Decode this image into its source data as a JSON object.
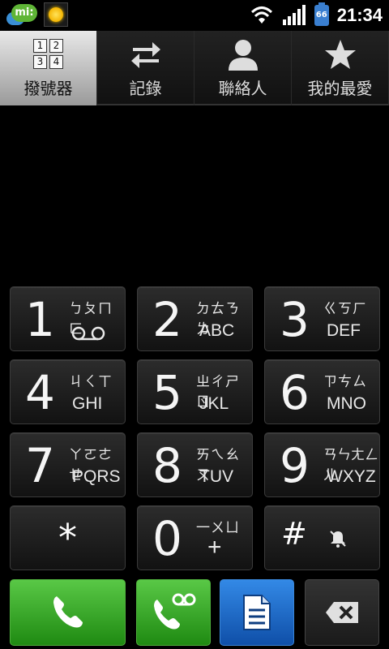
{
  "status_bar": {
    "mi_label": "mi:",
    "battery_level": "66",
    "time": "21:34"
  },
  "tabs": [
    {
      "label": "撥號器",
      "icon": "dialpad-icon",
      "active": true,
      "grid_digits": [
        "1",
        "2",
        "3",
        "4"
      ]
    },
    {
      "label": "記錄",
      "icon": "swap-arrows-icon",
      "active": false
    },
    {
      "label": "聯絡人",
      "icon": "person-icon",
      "active": false
    },
    {
      "label": "我的最愛",
      "icon": "star-icon",
      "active": false
    }
  ],
  "keys": [
    {
      "digit": "1",
      "zhuyin": "ㄅㄆㄇㄈ",
      "letters": "ꝏ"
    },
    {
      "digit": "2",
      "zhuyin": "ㄉㄊㄋㄌ",
      "letters": "ABC"
    },
    {
      "digit": "3",
      "zhuyin": "ㄍㄎㄏ",
      "letters": "DEF"
    },
    {
      "digit": "4",
      "zhuyin": "ㄐㄑㄒ",
      "letters": "GHI"
    },
    {
      "digit": "5",
      "zhuyin": "ㄓㄔㄕㄖ",
      "letters": "JKL"
    },
    {
      "digit": "6",
      "zhuyin": "ㄗㄘㄙ",
      "letters": "MNO"
    },
    {
      "digit": "7",
      "zhuyin": "ㄚㄛㄜㄝ",
      "letters": "PQRS"
    },
    {
      "digit": "8",
      "zhuyin": "ㄞㄟㄠㄡ",
      "letters": "TUV"
    },
    {
      "digit": "9",
      "zhuyin": "ㄢㄣㄤㄥㄦ",
      "letters": "WXYZ"
    },
    {
      "digit": "*",
      "zhuyin": "",
      "letters": ""
    },
    {
      "digit": "0",
      "zhuyin": "一ㄨㄩ",
      "letters": "+"
    },
    {
      "digit": "#",
      "zhuyin": "",
      "letters": ""
    }
  ],
  "actions": [
    {
      "name": "call-button",
      "icon": "phone-icon"
    },
    {
      "name": "voicemail-button",
      "icon": "voicemail-phone-icon"
    },
    {
      "name": "message-button",
      "icon": "document-icon"
    },
    {
      "name": "delete-button",
      "icon": "backspace-icon"
    }
  ],
  "colors": {
    "call_green": "#3aa52a",
    "sms_blue": "#1f6fcf",
    "tab_active_bg": "#d0d0d0"
  }
}
